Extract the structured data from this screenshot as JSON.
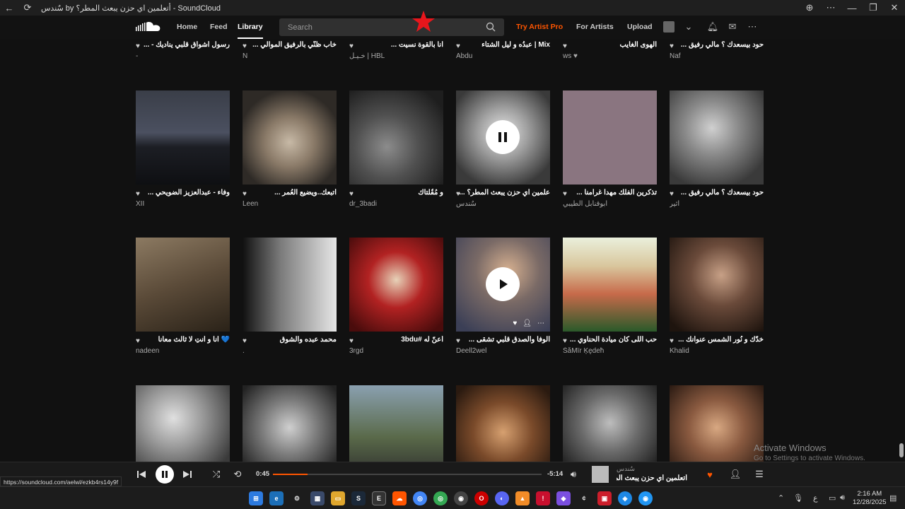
{
  "window": {
    "title": "سٌندس by أتعلمين اي حزن يبعث المطر؟ - SoundCloud"
  },
  "nav": {
    "home": "Home",
    "feed": "Feed",
    "library": "Library",
    "search_placeholder": "Search",
    "try_artist_pro": "Try Artist Pro",
    "for_artists": "For Artists",
    "upload": "Upload"
  },
  "top_row": [
    {
      "title": "رسول أشواق قلبي يناديك - ...",
      "user": "-"
    },
    {
      "title": "خاب ظنّي بالرفيق الموالي ...",
      "user": "N"
    },
    {
      "title": "انا بالقوة نسيت ...",
      "user": "خـيـل | HBL"
    },
    {
      "title": "Mix | عبدُه و ليل الشتاء",
      "user": "Abdu"
    },
    {
      "title": "الهوى الغايب",
      "user": "ws ♥"
    },
    {
      "title": "حود بيسعدك ؟ مالي رفيق ...",
      "user": "Naf"
    }
  ],
  "row2": [
    {
      "title": "وفاء - عبدالعزيز الضويحي ...",
      "user": "XII"
    },
    {
      "title": "أتبعك..ويضيع العُمر ...",
      "user": "Leen"
    },
    {
      "title": "و مُقُلتاك",
      "user": "dr_3badi"
    },
    {
      "title": "علمين اي حزن يبعث المطر؟ ...",
      "user": "سٌندس"
    },
    {
      "title": "تذكرين الفلك مهدا غرامنا ...",
      "user": "ابوقنابل الطيبي"
    },
    {
      "title": "حود بيسعدك ؟ مالي رفيق ...",
      "user": "أثير"
    }
  ],
  "row3": [
    {
      "title": "💙 انا و انتِ لا ثالث معانا",
      "user": "nadeen"
    },
    {
      "title": "محمد عبده والشوق",
      "user": "."
    },
    {
      "title": "أعنّ له #3bdu",
      "user": "3rgd"
    },
    {
      "title": "الوفا والصدق قلبي تشقى ...",
      "user": "Deell2wel"
    },
    {
      "title": "حب اللى كان ميادة الحناوي ...",
      "user": "ŠåMïr Ķędeħ"
    },
    {
      "title": "خدّك و نُور الشمس عنوانك ...",
      "user": "Khalid"
    }
  ],
  "player": {
    "elapsed": "0:45",
    "remaining": "-5:14",
    "progress": 0.13,
    "artist": "سٌندس",
    "track": "أتعلمين اي حزن يبعث المطر؟"
  },
  "status_url": "https://soundcloud.com/aelwl/ezkb4rs14y9f",
  "watermark": {
    "line1": "Activate Windows",
    "line2": "Go to Settings to activate Windows."
  },
  "taskbar": {
    "time": "2:16 AM",
    "date": "12/28/2025"
  },
  "colors": {
    "accent": "#ff5500",
    "background": "#111111"
  }
}
